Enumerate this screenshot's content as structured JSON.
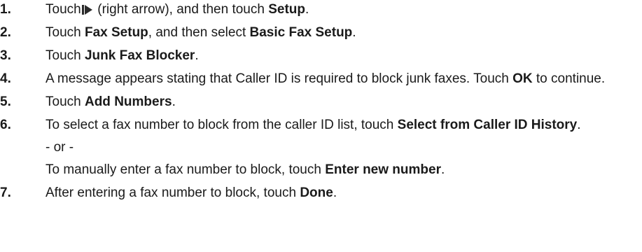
{
  "steps": [
    {
      "number": "1.",
      "t1": "Touch ",
      "icon": "right-arrow-icon",
      "t2": " (right arrow), and then touch ",
      "b1": "Setup",
      "t3": "."
    },
    {
      "number": "2.",
      "t1": "Touch ",
      "b1": "Fax Setup",
      "t2": ", and then select ",
      "b2": "Basic Fax Setup",
      "t3": "."
    },
    {
      "number": "3.",
      "t1": "Touch ",
      "b1": "Junk Fax Blocker",
      "t2": "."
    },
    {
      "number": "4.",
      "t1": "A message appears stating that Caller ID is required to block junk faxes. Touch ",
      "b1": "OK",
      "t2": " to continue."
    },
    {
      "number": "5.",
      "t1": "Touch ",
      "b1": "Add Numbers",
      "t2": "."
    },
    {
      "number": "6.",
      "t1": "To select a fax number to block from the caller ID list, touch ",
      "b1": "Select from Caller ID History",
      "t2": ".",
      "or": "- or -",
      "t3": "To manually enter a fax number to block, touch ",
      "b2": "Enter new number",
      "t4": "."
    },
    {
      "number": "7.",
      "t1": "After entering a fax number to block, touch ",
      "b1": "Done",
      "t2": "."
    }
  ]
}
